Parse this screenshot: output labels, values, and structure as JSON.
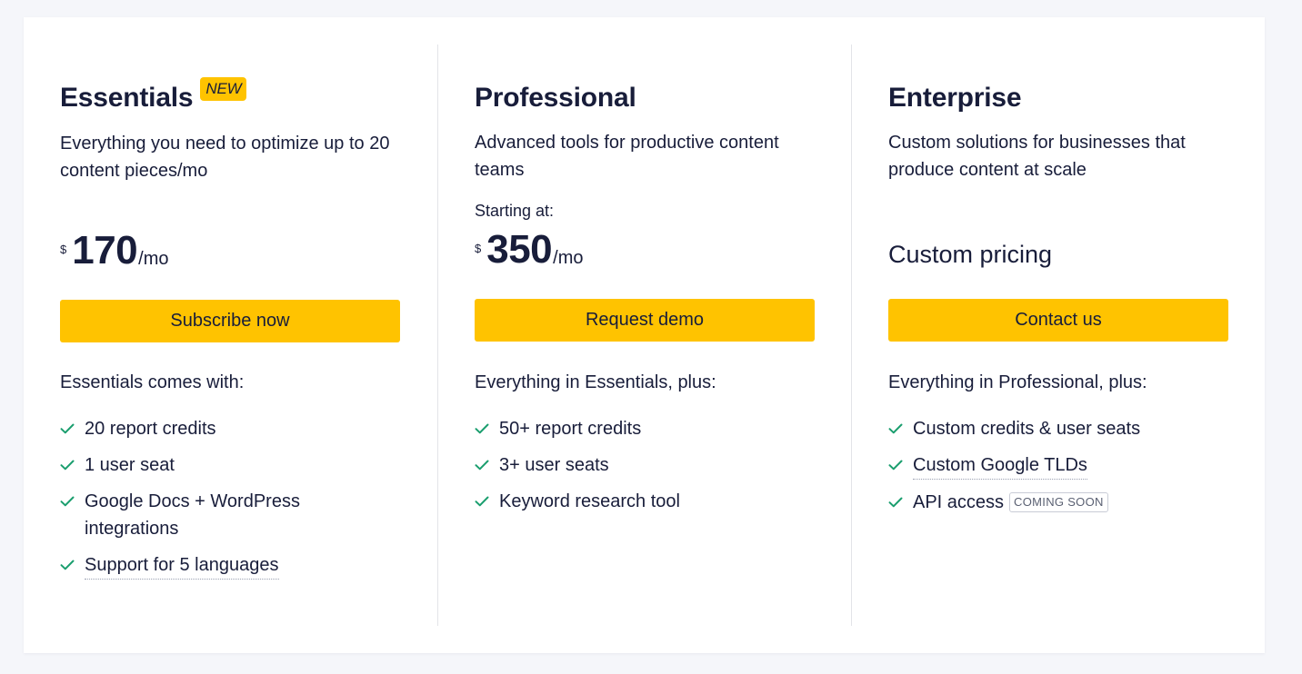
{
  "plans": [
    {
      "name": "Essentials",
      "badge": "NEW",
      "description": "Everything you need to optimize up to 20 content pieces/mo",
      "currency": "$",
      "price": "170",
      "period": "/mo",
      "cta": "Subscribe now",
      "includes": "Essentials comes with:",
      "features": [
        "20 report credits",
        "1 user seat",
        "Google Docs + WordPress integrations",
        "Support for 5 languages"
      ]
    },
    {
      "name": "Professional",
      "description": "Advanced tools for productive content teams",
      "starting_label": "Starting at:",
      "currency": "$",
      "price": "350",
      "period": "/mo",
      "cta": "Request demo",
      "includes": "Everything in Essentials, plus:",
      "features": [
        "50+ report credits",
        "3+ user seats",
        "Keyword research tool"
      ]
    },
    {
      "name": "Enterprise",
      "description": "Custom solutions for businesses that produce content at scale",
      "custom_price": "Custom pricing",
      "cta": "Contact us",
      "includes": "Everything in Professional, plus:",
      "features": [
        "Custom credits & user seats",
        "Custom Google TLDs",
        "API access"
      ],
      "feature_badge": "COMING SOON"
    }
  ],
  "colors": {
    "accent": "#ffc300",
    "check": "#1a9e6e",
    "text": "#181d3a",
    "divider": "#e3e4e8",
    "background": "#f5f6fa"
  },
  "icons": {
    "feature": "check-icon"
  }
}
